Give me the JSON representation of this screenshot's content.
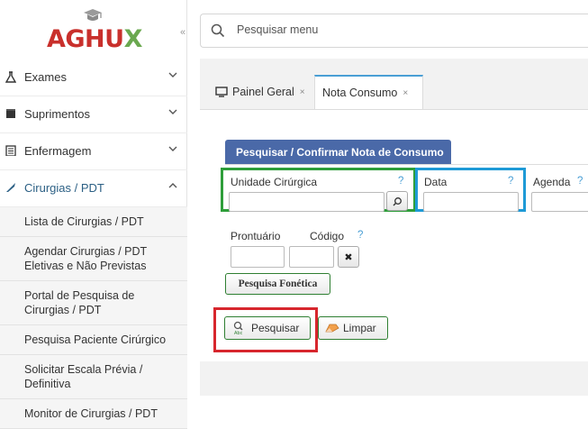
{
  "app": {
    "logo_text_a": "AGH",
    "logo_text_u": "U",
    "logo_text_x": "X"
  },
  "sidebar": {
    "items": [
      {
        "label": "Exames",
        "icon": "flask-icon"
      },
      {
        "label": "Suprimentos",
        "icon": "box-icon"
      },
      {
        "label": "Enfermagem",
        "icon": "clipboard-icon"
      },
      {
        "label": "Cirurgias / PDT",
        "icon": "scalpel-icon",
        "expanded": true
      }
    ],
    "subitems": [
      {
        "label": "Lista de Cirurgias / PDT"
      },
      {
        "label": "Agendar Cirurgias / PDT Eletivas e Não Previstas"
      },
      {
        "label": "Portal de Pesquisa de Cirurgias / PDT"
      },
      {
        "label": "Pesquisa Paciente Cirúrgico"
      },
      {
        "label": "Solicitar Escala Prévia / Definitiva"
      },
      {
        "label": "Monitor de Cirurgias / PDT"
      }
    ]
  },
  "search": {
    "placeholder": "Pesquisar menu"
  },
  "tabs": [
    {
      "label": "Painel Geral",
      "close": "×"
    },
    {
      "label": "Nota Consumo",
      "close": "×",
      "active": true
    }
  ],
  "form": {
    "title": "Pesquisar / Confirmar Nota de Consumo",
    "unidade_label": "Unidade Cirúrgica",
    "data_label": "Data",
    "agenda_label": "Agenda",
    "prontuario_label": "Prontuário",
    "codigo_label": "Código",
    "help": "?",
    "clear_x": "✖",
    "fonetica_label": "Pesquisa Fonética",
    "pesquisar_label": "Pesquisar",
    "limpar_label": "Limpar"
  },
  "colors": {
    "highlight_green": "#2e9e3a",
    "highlight_blue": "#1e9ad6",
    "highlight_red": "#d7262d",
    "header_blue": "#4a69a8"
  }
}
